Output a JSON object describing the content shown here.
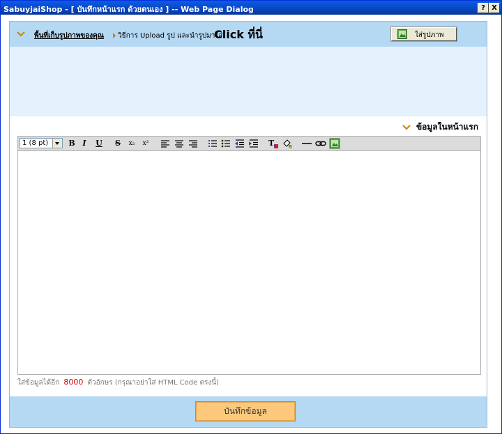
{
  "window": {
    "title": "SabuyjaiShop - [ บันทึกหน้าแรก ด้วยตนเอง ] -- Web Page Dialog",
    "help_label": "?",
    "close_label": "X"
  },
  "upload": {
    "link_label": "พื้นที่เก็บรูปภาพของคุณ",
    "howto_text": "วิธีการ Upload รูป และนำรูปมาใส่",
    "click_label": "Click ที่นี่",
    "insert_button_label": "ใส่รูปภาพ"
  },
  "section": {
    "front_info_label": "ข้อมูลในหน้าแรก"
  },
  "toolbar": {
    "font_size_value": "1 (8 pt)",
    "bold": "B",
    "italic": "I",
    "underline": "U",
    "strike": "S",
    "subscript": "x₂",
    "superscript": "x²"
  },
  "footer": {
    "limit_prefix": "ใส่ข้อมูลได้อีก",
    "limit_count": "8000",
    "limit_suffix": "ตัวอักษร (กรุณาอย่าใส่ HTML Code ตรงนี้)",
    "save_label": "บันทึกข้อมูล"
  },
  "colors": {
    "accent": "#b5d8f3",
    "image_area": "#e3f2fd",
    "save_button": "#fcc97c",
    "limit_count": "#e00000"
  }
}
